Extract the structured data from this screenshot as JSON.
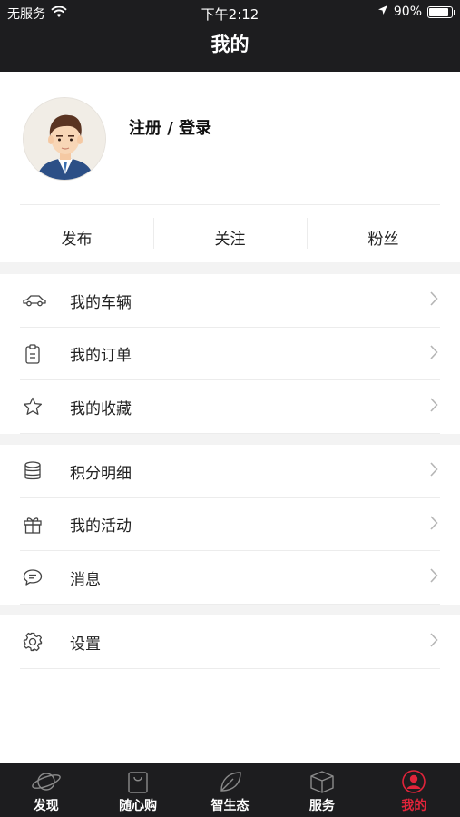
{
  "status_bar": {
    "carrier": "无服务",
    "time": "下午2:12",
    "battery_percent": "90%",
    "battery_level": 0.9
  },
  "header": {
    "title": "我的"
  },
  "profile": {
    "login_text": "注册 / 登录",
    "stats": [
      "发布",
      "关注",
      "粉丝"
    ]
  },
  "menu_sections": [
    [
      {
        "label": "我的车辆",
        "icon": "car-icon"
      },
      {
        "label": "我的订单",
        "icon": "clipboard-icon"
      },
      {
        "label": "我的收藏",
        "icon": "star-icon"
      }
    ],
    [
      {
        "label": "积分明细",
        "icon": "coins-icon"
      },
      {
        "label": "我的活动",
        "icon": "gift-icon"
      },
      {
        "label": "消息",
        "icon": "message-icon"
      }
    ],
    [
      {
        "label": "设置",
        "icon": "gear-icon"
      }
    ]
  ],
  "tabbar": {
    "items": [
      {
        "label": "发现",
        "icon": "planet-icon"
      },
      {
        "label": "随心购",
        "icon": "shopping-bag-icon"
      },
      {
        "label": "智生态",
        "icon": "leaf-icon"
      },
      {
        "label": "服务",
        "icon": "box-icon"
      },
      {
        "label": "我的",
        "icon": "user-icon"
      }
    ],
    "active_index": 4
  },
  "colors": {
    "header_bg": "#1d1d1f",
    "active_tab": "#e0243a",
    "divider": "#ececec",
    "section_gap": "#f3f3f3"
  }
}
